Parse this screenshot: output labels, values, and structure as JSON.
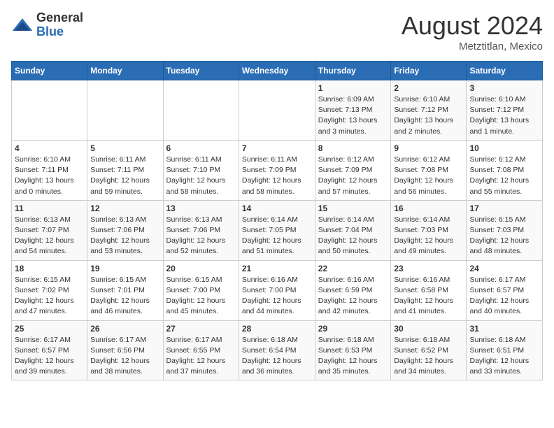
{
  "header": {
    "logo_general": "General",
    "logo_blue": "Blue",
    "month_title": "August 2024",
    "location": "Metztitlan, Mexico"
  },
  "weekdays": [
    "Sunday",
    "Monday",
    "Tuesday",
    "Wednesday",
    "Thursday",
    "Friday",
    "Saturday"
  ],
  "weeks": [
    [
      {
        "day": "",
        "sunrise": "",
        "sunset": "",
        "daylight": ""
      },
      {
        "day": "",
        "sunrise": "",
        "sunset": "",
        "daylight": ""
      },
      {
        "day": "",
        "sunrise": "",
        "sunset": "",
        "daylight": ""
      },
      {
        "day": "",
        "sunrise": "",
        "sunset": "",
        "daylight": ""
      },
      {
        "day": "1",
        "sunrise": "Sunrise: 6:09 AM",
        "sunset": "Sunset: 7:13 PM",
        "daylight": "Daylight: 13 hours and 3 minutes."
      },
      {
        "day": "2",
        "sunrise": "Sunrise: 6:10 AM",
        "sunset": "Sunset: 7:12 PM",
        "daylight": "Daylight: 13 hours and 2 minutes."
      },
      {
        "day": "3",
        "sunrise": "Sunrise: 6:10 AM",
        "sunset": "Sunset: 7:12 PM",
        "daylight": "Daylight: 13 hours and 1 minute."
      }
    ],
    [
      {
        "day": "4",
        "sunrise": "Sunrise: 6:10 AM",
        "sunset": "Sunset: 7:11 PM",
        "daylight": "Daylight: 13 hours and 0 minutes."
      },
      {
        "day": "5",
        "sunrise": "Sunrise: 6:11 AM",
        "sunset": "Sunset: 7:11 PM",
        "daylight": "Daylight: 12 hours and 59 minutes."
      },
      {
        "day": "6",
        "sunrise": "Sunrise: 6:11 AM",
        "sunset": "Sunset: 7:10 PM",
        "daylight": "Daylight: 12 hours and 58 minutes."
      },
      {
        "day": "7",
        "sunrise": "Sunrise: 6:11 AM",
        "sunset": "Sunset: 7:09 PM",
        "daylight": "Daylight: 12 hours and 58 minutes."
      },
      {
        "day": "8",
        "sunrise": "Sunrise: 6:12 AM",
        "sunset": "Sunset: 7:09 PM",
        "daylight": "Daylight: 12 hours and 57 minutes."
      },
      {
        "day": "9",
        "sunrise": "Sunrise: 6:12 AM",
        "sunset": "Sunset: 7:08 PM",
        "daylight": "Daylight: 12 hours and 56 minutes."
      },
      {
        "day": "10",
        "sunrise": "Sunrise: 6:12 AM",
        "sunset": "Sunset: 7:08 PM",
        "daylight": "Daylight: 12 hours and 55 minutes."
      }
    ],
    [
      {
        "day": "11",
        "sunrise": "Sunrise: 6:13 AM",
        "sunset": "Sunset: 7:07 PM",
        "daylight": "Daylight: 12 hours and 54 minutes."
      },
      {
        "day": "12",
        "sunrise": "Sunrise: 6:13 AM",
        "sunset": "Sunset: 7:06 PM",
        "daylight": "Daylight: 12 hours and 53 minutes."
      },
      {
        "day": "13",
        "sunrise": "Sunrise: 6:13 AM",
        "sunset": "Sunset: 7:06 PM",
        "daylight": "Daylight: 12 hours and 52 minutes."
      },
      {
        "day": "14",
        "sunrise": "Sunrise: 6:14 AM",
        "sunset": "Sunset: 7:05 PM",
        "daylight": "Daylight: 12 hours and 51 minutes."
      },
      {
        "day": "15",
        "sunrise": "Sunrise: 6:14 AM",
        "sunset": "Sunset: 7:04 PM",
        "daylight": "Daylight: 12 hours and 50 minutes."
      },
      {
        "day": "16",
        "sunrise": "Sunrise: 6:14 AM",
        "sunset": "Sunset: 7:03 PM",
        "daylight": "Daylight: 12 hours and 49 minutes."
      },
      {
        "day": "17",
        "sunrise": "Sunrise: 6:15 AM",
        "sunset": "Sunset: 7:03 PM",
        "daylight": "Daylight: 12 hours and 48 minutes."
      }
    ],
    [
      {
        "day": "18",
        "sunrise": "Sunrise: 6:15 AM",
        "sunset": "Sunset: 7:02 PM",
        "daylight": "Daylight: 12 hours and 47 minutes."
      },
      {
        "day": "19",
        "sunrise": "Sunrise: 6:15 AM",
        "sunset": "Sunset: 7:01 PM",
        "daylight": "Daylight: 12 hours and 46 minutes."
      },
      {
        "day": "20",
        "sunrise": "Sunrise: 6:15 AM",
        "sunset": "Sunset: 7:00 PM",
        "daylight": "Daylight: 12 hours and 45 minutes."
      },
      {
        "day": "21",
        "sunrise": "Sunrise: 6:16 AM",
        "sunset": "Sunset: 7:00 PM",
        "daylight": "Daylight: 12 hours and 44 minutes."
      },
      {
        "day": "22",
        "sunrise": "Sunrise: 6:16 AM",
        "sunset": "Sunset: 6:59 PM",
        "daylight": "Daylight: 12 hours and 42 minutes."
      },
      {
        "day": "23",
        "sunrise": "Sunrise: 6:16 AM",
        "sunset": "Sunset: 6:58 PM",
        "daylight": "Daylight: 12 hours and 41 minutes."
      },
      {
        "day": "24",
        "sunrise": "Sunrise: 6:17 AM",
        "sunset": "Sunset: 6:57 PM",
        "daylight": "Daylight: 12 hours and 40 minutes."
      }
    ],
    [
      {
        "day": "25",
        "sunrise": "Sunrise: 6:17 AM",
        "sunset": "Sunset: 6:57 PM",
        "daylight": "Daylight: 12 hours and 39 minutes."
      },
      {
        "day": "26",
        "sunrise": "Sunrise: 6:17 AM",
        "sunset": "Sunset: 6:56 PM",
        "daylight": "Daylight: 12 hours and 38 minutes."
      },
      {
        "day": "27",
        "sunrise": "Sunrise: 6:17 AM",
        "sunset": "Sunset: 6:55 PM",
        "daylight": "Daylight: 12 hours and 37 minutes."
      },
      {
        "day": "28",
        "sunrise": "Sunrise: 6:18 AM",
        "sunset": "Sunset: 6:54 PM",
        "daylight": "Daylight: 12 hours and 36 minutes."
      },
      {
        "day": "29",
        "sunrise": "Sunrise: 6:18 AM",
        "sunset": "Sunset: 6:53 PM",
        "daylight": "Daylight: 12 hours and 35 minutes."
      },
      {
        "day": "30",
        "sunrise": "Sunrise: 6:18 AM",
        "sunset": "Sunset: 6:52 PM",
        "daylight": "Daylight: 12 hours and 34 minutes."
      },
      {
        "day": "31",
        "sunrise": "Sunrise: 6:18 AM",
        "sunset": "Sunset: 6:51 PM",
        "daylight": "Daylight: 12 hours and 33 minutes."
      }
    ]
  ]
}
